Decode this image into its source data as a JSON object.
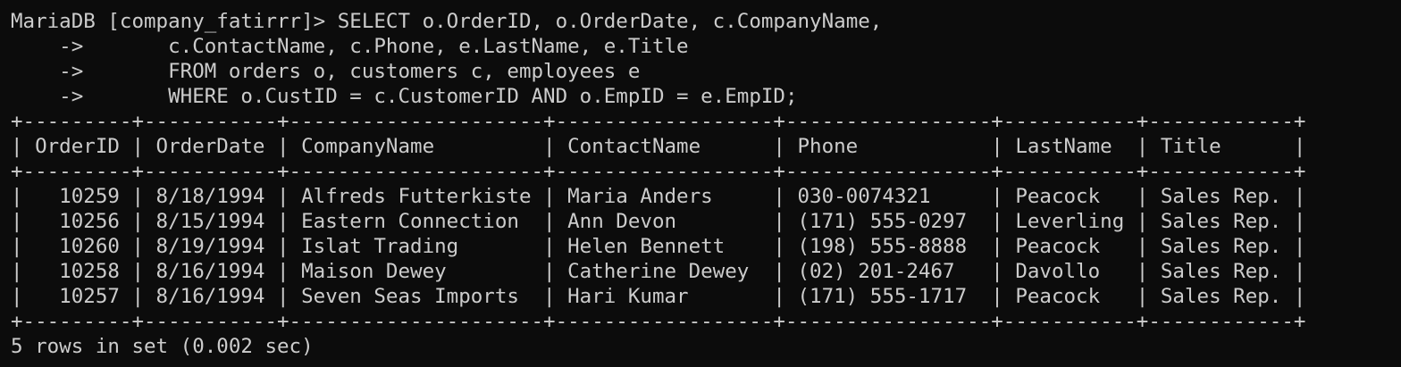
{
  "terminal": {
    "prompt": "MariaDB [company_fatirrr]> ",
    "query_lines": [
      "SELECT o.OrderID, o.OrderDate, c.CompanyName,",
      "    ->       c.ContactName, c.Phone, e.LastName, e.Title",
      "    ->       FROM orders o, customers c, employees e",
      "    ->       WHERE o.CustID = c.CustomerID AND o.EmpID = e.EmpID;"
    ],
    "table": {
      "border": "+---------+-----------+---------------------+------------------+-----------------+-----------+------------+",
      "header": "| OrderID | OrderDate | CompanyName         | ContactName      | Phone           | LastName  | Title      |",
      "rows": [
        "|   10259 | 8/18/1994 | Alfreds Futterkiste | Maria Anders     | 030-0074321     | Peacock   | Sales Rep. |",
        "|   10256 | 8/15/1994 | Eastern Connection  | Ann Devon        | (171) 555-0297  | Leverling | Sales Rep. |",
        "|   10260 | 8/19/1994 | Islat Trading       | Helen Bennett    | (198) 555-8888  | Peacock   | Sales Rep. |",
        "|   10258 | 8/16/1994 | Maison Dewey        | Catherine Dewey  | (02) 201-2467   | Davollo   | Sales Rep. |",
        "|   10257 | 8/16/1994 | Seven Seas Imports  | Hari Kumar       | (171) 555-1717  | Peacock   | Sales Rep. |"
      ]
    },
    "status": "5 rows in set (0.002 sec)"
  }
}
